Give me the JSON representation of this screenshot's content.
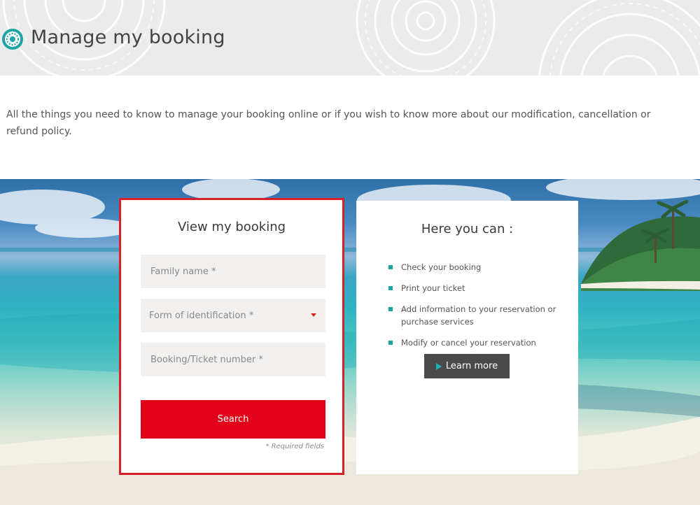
{
  "header": {
    "title": "Manage my booking"
  },
  "intro": {
    "text": "All the things you need to know to manage your booking online or if you wish to know more about our modification, cancellation or refund policy."
  },
  "booking_form": {
    "title": "View my booking",
    "family_name_placeholder": "Family name *",
    "identification_placeholder": "Form of identification *",
    "ticket_number_placeholder": "Booking/Ticket number *",
    "search_label": "Search",
    "required_note": "* Required fields"
  },
  "info_panel": {
    "title": "Here you can :",
    "items": [
      "Check your booking",
      "Print your ticket",
      "Add information to your reservation or purchase services",
      "Modify or cancel your reservation"
    ],
    "learn_more_label": "Learn more"
  },
  "colors": {
    "accent_red": "#e2001a",
    "highlight_border": "#d8202b",
    "bullet_teal": "#1fa3a6",
    "button_dark": "#4a4a4a"
  },
  "icons": {
    "logo": "sun-medallion-icon",
    "caret": "caret-down-icon",
    "play": "play-icon"
  }
}
